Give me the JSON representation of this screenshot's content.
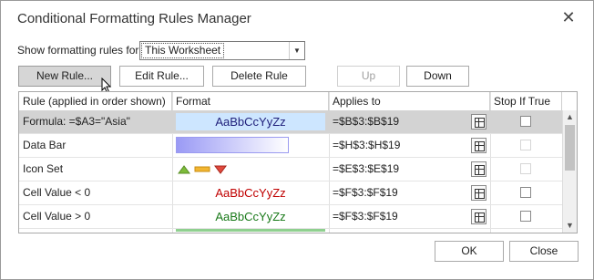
{
  "window": {
    "title": "Conditional Formatting Rules Manager"
  },
  "filter": {
    "label": "Show formatting rules for:",
    "value": "This Worksheet"
  },
  "toolbar": {
    "new_rule": "New Rule...",
    "edit_rule": "Edit Rule...",
    "delete_rule": "Delete Rule",
    "up": "Up",
    "down": "Down"
  },
  "columns": {
    "rule": "Rule (applied in order shown)",
    "format": "Format",
    "applies": "Applies to",
    "stop": "Stop If True"
  },
  "rules": [
    {
      "rule": "Formula: =$A3=\"Asia\"",
      "preview": "AaBbCcYyZz",
      "applies": "=$B$3:$B$19",
      "selected": true,
      "preview_color": "#1f1f7a",
      "preview_bg": "#cde6ff"
    },
    {
      "rule": "Data Bar",
      "applies": "=$H$3:$H$19",
      "selected": false
    },
    {
      "rule": "Icon Set",
      "applies": "=$E$3:$E$19",
      "selected": false
    },
    {
      "rule": "Cell Value < 0",
      "preview": "AaBbCcYyZz",
      "applies": "=$F$3:$F$19",
      "selected": false,
      "preview_color": "#c00000"
    },
    {
      "rule": "Cell Value > 0",
      "preview": "AaBbCcYyZz",
      "applies": "=$F$3:$F$19",
      "selected": false,
      "preview_color": "#1a7a1a"
    }
  ],
  "footer": {
    "ok": "OK",
    "close": "Close"
  },
  "icons": {
    "close": "close-icon",
    "dropdown": "chevron-down-icon",
    "range_picker": "range-select-icon",
    "scroll_up": "chevron-up-icon",
    "scroll_down": "chevron-down-icon"
  }
}
